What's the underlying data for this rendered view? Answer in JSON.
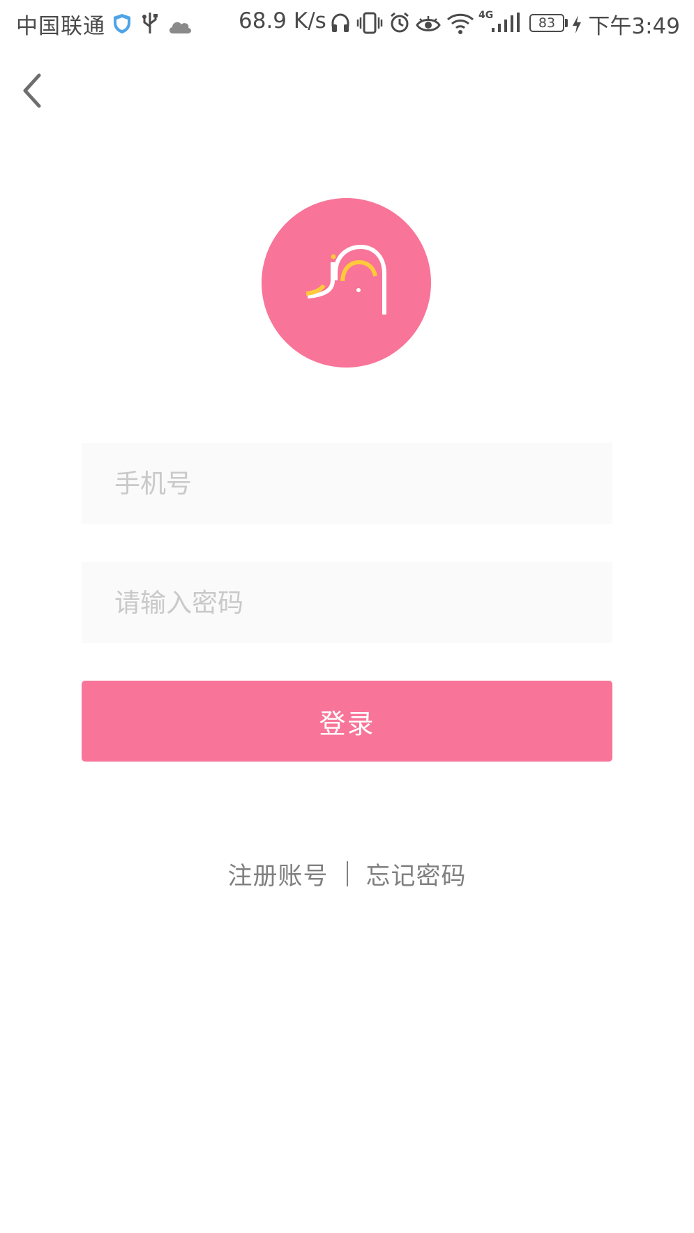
{
  "status_bar": {
    "carrier": "中国联通",
    "net_speed": "68.9 K/s",
    "network_type": "4G",
    "battery": "83",
    "time": "下午3:49"
  },
  "icons": {
    "back": "chevron-left-icon"
  },
  "form": {
    "phone_placeholder": "手机号",
    "password_placeholder": "请输入密码",
    "login_label": "登录"
  },
  "links": {
    "register": "注册账号",
    "forgot": "忘记密码"
  },
  "colors": {
    "accent": "#f87498",
    "logo_yellow": "#ffc93c",
    "input_bg": "#fafafa",
    "link_gray": "#808080"
  }
}
